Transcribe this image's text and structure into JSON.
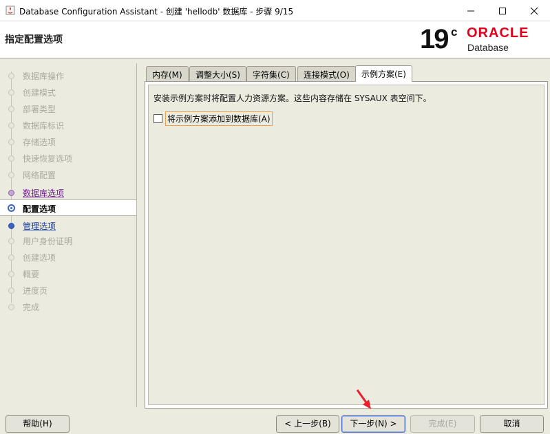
{
  "window": {
    "title": "Database Configuration Assistant - 创建 'hellodb' 数据库 - 步骤 9/15"
  },
  "header": {
    "heading": "指定配置选项",
    "logo_version": "19",
    "logo_c": "c",
    "logo_brand": "ORACLE",
    "logo_product": "Database"
  },
  "nav": {
    "items": [
      {
        "label": "数据库操作",
        "state": "disabled"
      },
      {
        "label": "创建模式",
        "state": "disabled"
      },
      {
        "label": "部署类型",
        "state": "disabled"
      },
      {
        "label": "数据库标识",
        "state": "disabled"
      },
      {
        "label": "存储选项",
        "state": "disabled"
      },
      {
        "label": "快速恢复选项",
        "state": "disabled"
      },
      {
        "label": "网络配置",
        "state": "disabled"
      },
      {
        "label": "数据库选项",
        "state": "visited"
      },
      {
        "label": "配置选项",
        "state": "current"
      },
      {
        "label": "管理选项",
        "state": "link"
      },
      {
        "label": "用户身份证明",
        "state": "disabled"
      },
      {
        "label": "创建选项",
        "state": "disabled"
      },
      {
        "label": "概要",
        "state": "disabled"
      },
      {
        "label": "进度页",
        "state": "disabled"
      },
      {
        "label": "完成",
        "state": "disabled"
      }
    ]
  },
  "tabs": [
    {
      "label": "内存(M)"
    },
    {
      "label": "调整大小(S)"
    },
    {
      "label": "字符集(C)"
    },
    {
      "label": "连接模式(O)"
    },
    {
      "label": "示例方案(E)"
    }
  ],
  "panel": {
    "description": "安装示例方案时将配置人力资源方案。这些内容存储在 SYSAUX 表空间下。",
    "checkbox_label": "将示例方案添加到数据库(A)",
    "checkbox_checked": false
  },
  "buttons": {
    "help": "帮助(H)",
    "back": "< 上一步(B)",
    "next": "下一步(N) >",
    "finish": "完成(E)",
    "cancel": "取消"
  },
  "colors": {
    "oracle_red": "#e3001b",
    "link_blue": "#1a3f9c",
    "visited_purple": "#6d1e8d",
    "annotation_arrow": "#e8212a"
  }
}
